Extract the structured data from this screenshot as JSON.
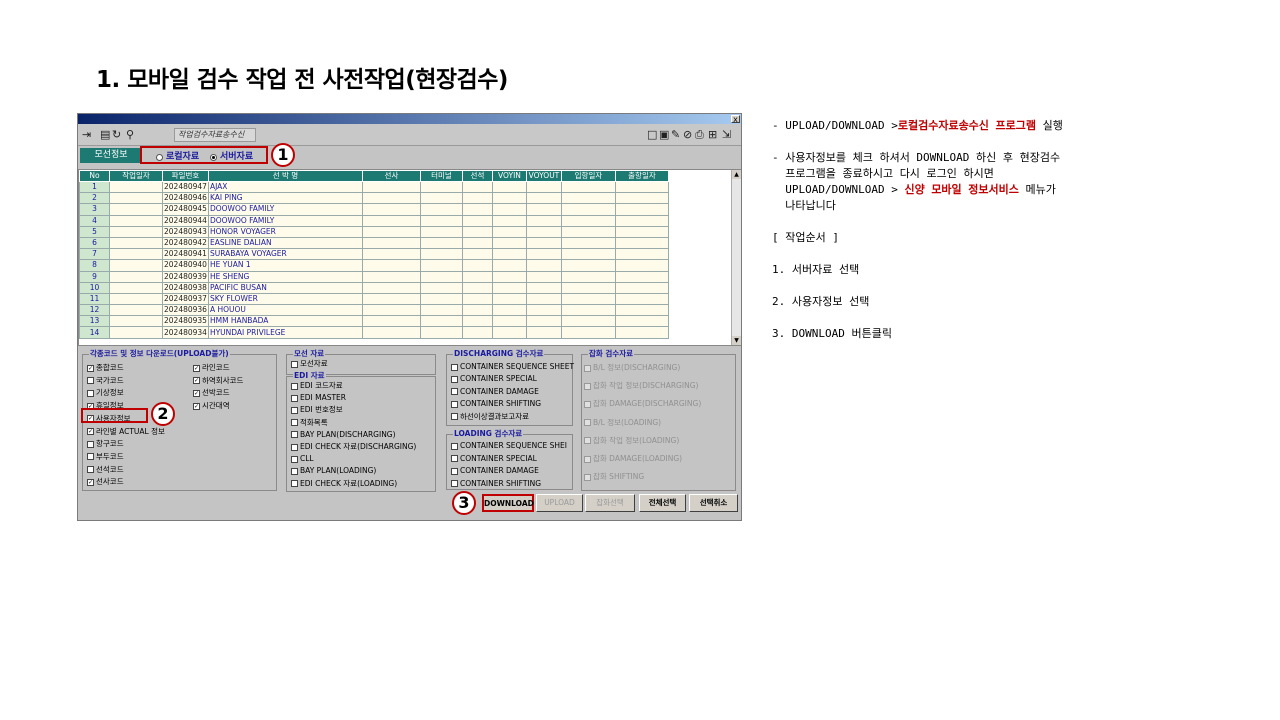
{
  "slide_title": "1. 모바일 검수 작업 전 사전작업(현장검수)",
  "window": {
    "close_glyph": "x",
    "toolbar_title": "작업검수자료송수신",
    "tab_label": "모선정보",
    "radio_local": "로컬자료",
    "radio_server": "서버자료"
  },
  "badges": [
    "1",
    "2",
    "3"
  ],
  "grid": {
    "headers": [
      "No",
      "작업일자",
      "파일번호",
      "선 박 명",
      "선사",
      "터미널",
      "선석",
      "VOYIN",
      "VOYOUT",
      "입항일자",
      "출항일자"
    ],
    "rows": [
      {
        "no": "1",
        "file": "202480947",
        "ship": "AJAX"
      },
      {
        "no": "2",
        "file": "202480946",
        "ship": "KAI PING"
      },
      {
        "no": "3",
        "file": "202480945",
        "ship": "DOOWOO FAMILY"
      },
      {
        "no": "4",
        "file": "202480944",
        "ship": "DOOWOO FAMILY"
      },
      {
        "no": "5",
        "file": "202480943",
        "ship": "HONOR VOYAGER"
      },
      {
        "no": "6",
        "file": "202480942",
        "ship": "EASLINE DALIAN"
      },
      {
        "no": "7",
        "file": "202480941",
        "ship": "SURABAYA VOYAGER"
      },
      {
        "no": "8",
        "file": "202480940",
        "ship": "HE YUAN 1"
      },
      {
        "no": "9",
        "file": "202480939",
        "ship": "HE SHENG"
      },
      {
        "no": "10",
        "file": "202480938",
        "ship": "PACIFIC BUSAN"
      },
      {
        "no": "11",
        "file": "202480937",
        "ship": "SKY FLOWER"
      },
      {
        "no": "12",
        "file": "202480936",
        "ship": "A HOUOU"
      },
      {
        "no": "13",
        "file": "202480935",
        "ship": "HMM HANBADA"
      },
      {
        "no": "14",
        "file": "202480934",
        "ship": "HYUNDAI PRIVILEGE"
      }
    ]
  },
  "codes_group": {
    "title": "각종코드 및 정보 다운로드(UPLOAD불가)",
    "left": [
      {
        "label": "종합코드",
        "checked": true
      },
      {
        "label": "국가코드",
        "checked": false
      },
      {
        "label": "기상정보",
        "checked": false
      },
      {
        "label": "휴일정보",
        "checked": true
      },
      {
        "label": "사용자정보",
        "checked": true
      },
      {
        "label": "라인별 ACTUAL 정보",
        "checked": true
      },
      {
        "label": "항구코드",
        "checked": false
      },
      {
        "label": "부두코드",
        "checked": false
      },
      {
        "label": "선석코드",
        "checked": false
      },
      {
        "label": "선사코드",
        "checked": true
      }
    ],
    "right": [
      {
        "label": "라인코드",
        "checked": true
      },
      {
        "label": "하역회사코드",
        "checked": true
      },
      {
        "label": "선박코드",
        "checked": true
      },
      {
        "label": "시간대역",
        "checked": true
      }
    ]
  },
  "ship_group": {
    "title": "모선 자료",
    "items": [
      {
        "label": "모선자료",
        "checked": false
      }
    ]
  },
  "edi_group": {
    "title": "EDI 자료",
    "items": [
      {
        "label": "EDI 코드자료",
        "checked": false
      },
      {
        "label": "EDI MASTER",
        "checked": false
      },
      {
        "label": "EDI 번호정보",
        "checked": false
      },
      {
        "label": "적화목록",
        "checked": false
      },
      {
        "label": "BAY PLAN(DISCHARGING)",
        "checked": false
      },
      {
        "label": "EDI CHECK 자료(DISCHARGING)",
        "checked": false
      },
      {
        "label": "CLL",
        "checked": false
      },
      {
        "label": "BAY PLAN(LOADING)",
        "checked": false
      },
      {
        "label": "EDI CHECK 자료(LOADING)",
        "checked": false
      }
    ]
  },
  "discharging_group": {
    "title": "DISCHARGING 검수자료",
    "items": [
      {
        "label": "CONTAINER SEQUENCE SHEET",
        "checked": false
      },
      {
        "label": "CONTAINER SPECIAL",
        "checked": false
      },
      {
        "label": "CONTAINER DAMAGE",
        "checked": false
      },
      {
        "label": "CONTAINER SHIFTING",
        "checked": false
      },
      {
        "label": "하선이상결과보고자료",
        "checked": false
      }
    ]
  },
  "loading_group": {
    "title": "LOADING 검수자료",
    "items": [
      {
        "label": "CONTAINER SEQUENCE SHEI",
        "checked": false
      },
      {
        "label": "CONTAINER SPECIAL",
        "checked": false
      },
      {
        "label": "CONTAINER DAMAGE",
        "checked": false
      },
      {
        "label": "CONTAINER SHIFTING",
        "checked": false
      }
    ]
  },
  "misc_group": {
    "title": "잡화 검수자료",
    "items": [
      {
        "label": "B/L 정보(DISCHARGING)",
        "checked": false
      },
      {
        "label": "잡화 작업 정보(DISCHARGING)",
        "checked": false
      },
      {
        "label": "잡화 DAMAGE(DISCHARGING)",
        "checked": false
      },
      {
        "label": "B/L 정보(LOADING)",
        "checked": false
      },
      {
        "label": "잡화 작업 정보(LOADING)",
        "checked": false
      },
      {
        "label": "잡화 DAMAGE(LOADING)",
        "checked": false
      },
      {
        "label": "잡화 SHIFTING",
        "checked": false
      }
    ]
  },
  "buttons": {
    "download": "DOWNLOAD",
    "upload": "UPLOAD",
    "misc_select": "잡화선택",
    "select_all": "전체선택",
    "cancel_select": "선택취소"
  },
  "notes": {
    "l1_prefix": "- UPLOAD/DOWNLOAD >",
    "l1_red": "로컬검수자료송수신 프로그램",
    "l1_suffix": " 실행",
    "l2": "- 사용자정보를 체크 하셔서 DOWNLOAD 하신 후 현장검수",
    "l3": "  프로그램을 종료하시고 다시 로그인 하시면",
    "l4_prefix": "  UPLOAD/DOWNLOAD > ",
    "l4_red": "신양 모바일 정보서비스",
    "l4_suffix": " 메뉴가",
    "l5": "  나타납니다",
    "l6": "[ 작업순서 ]",
    "l7": "1. 서버자료 선택",
    "l8": "2. 사용자정보 선택",
    "l9": "3. DOWNLOAD 버튼클릭"
  }
}
